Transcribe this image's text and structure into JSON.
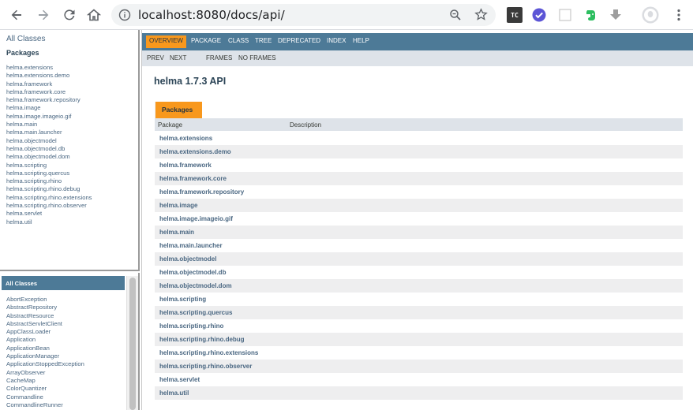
{
  "browser": {
    "url": "localhost:8080/docs/api/",
    "ext_tc_label": "TC"
  },
  "package_frame": {
    "all_classes_link": "All Classes",
    "heading": "Packages",
    "packages": [
      "helma.extensions",
      "helma.extensions.demo",
      "helma.framework",
      "helma.framework.core",
      "helma.framework.repository",
      "helma.image",
      "helma.image.imageio.gif",
      "helma.main",
      "helma.main.launcher",
      "helma.objectmodel",
      "helma.objectmodel.db",
      "helma.objectmodel.dom",
      "helma.scripting",
      "helma.scripting.quercus",
      "helma.scripting.rhino",
      "helma.scripting.rhino.debug",
      "helma.scripting.rhino.extensions",
      "helma.scripting.rhino.observer",
      "helma.servlet",
      "helma.util"
    ]
  },
  "class_frame": {
    "heading": "All Classes",
    "classes": [
      "AbortException",
      "AbstractRepository",
      "AbstractResource",
      "AbstractServletClient",
      "AppClassLoader",
      "Application",
      "ApplicationBean",
      "ApplicationManager",
      "ApplicationStoppedException",
      "ArrayObserver",
      "CacheMap",
      "ColorQuantizer",
      "Commandline",
      "CommandlineRunner"
    ]
  },
  "main_frame": {
    "nav": [
      "OVERVIEW",
      "PACKAGE",
      "CLASS",
      "TREE",
      "DEPRECATED",
      "INDEX",
      "HELP"
    ],
    "subnav": [
      "PREV",
      "NEXT",
      "FRAMES",
      "NO FRAMES"
    ],
    "title": "helma 1.7.3 API",
    "tab_label": "Packages",
    "table_headers": [
      "Package",
      "Description"
    ],
    "rows": [
      "helma.extensions",
      "helma.extensions.demo",
      "helma.framework",
      "helma.framework.core",
      "helma.framework.repository",
      "helma.image",
      "helma.image.imageio.gif",
      "helma.main",
      "helma.main.launcher",
      "helma.objectmodel",
      "helma.objectmodel.db",
      "helma.objectmodel.dom",
      "helma.scripting",
      "helma.scripting.quercus",
      "helma.scripting.rhino",
      "helma.scripting.rhino.debug",
      "helma.scripting.rhino.extensions",
      "helma.scripting.rhino.observer",
      "helma.servlet",
      "helma.util"
    ]
  },
  "colors": {
    "nav_bar": "#4d7a97",
    "nav_active": "#f8981d",
    "subnav_bg": "#dee3e9",
    "row_alt": "#eeeeef",
    "link": "#4a6782"
  }
}
